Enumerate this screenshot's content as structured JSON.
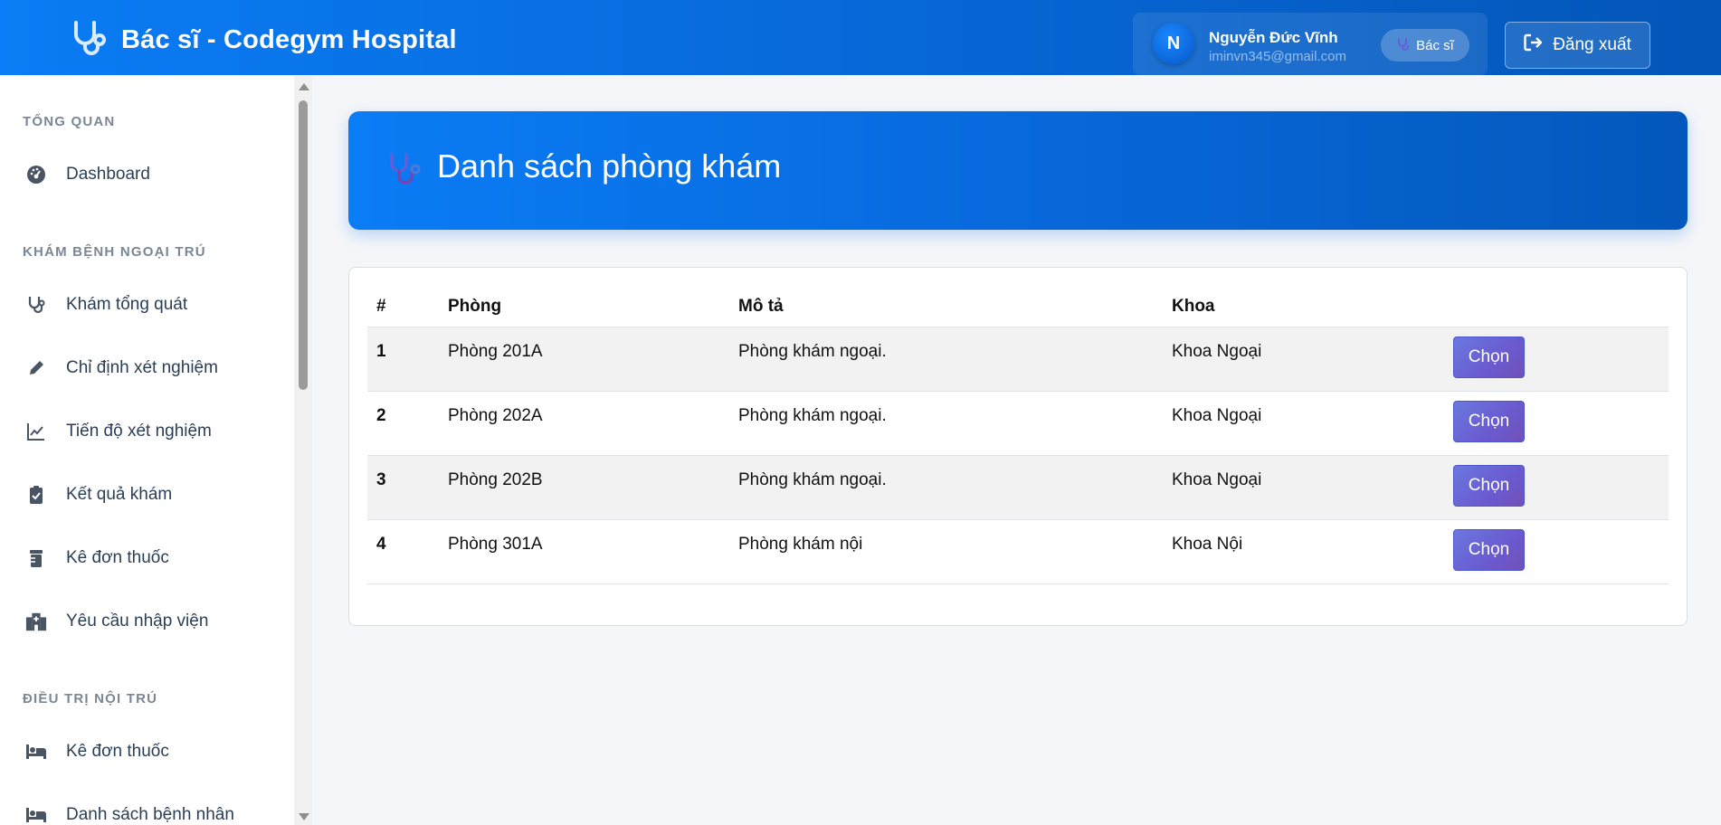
{
  "header": {
    "brand_title": "Bác sĩ - Codegym Hospital",
    "user_initial": "N",
    "user_name": "Nguyễn Đức Vĩnh",
    "user_email": "iminvn345@gmail.com",
    "role_label": "Bác sĩ",
    "logout_label": "Đăng xuất"
  },
  "sidebar": {
    "sections": [
      {
        "title": "TỔNG QUAN"
      },
      {
        "title": "KHÁM BỆNH NGOẠI TRÚ"
      },
      {
        "title": "ĐIỀU TRỊ NỘI TRÚ"
      }
    ],
    "items": [
      {
        "label": "Dashboard",
        "icon": "gauge-icon"
      },
      {
        "label": "Khám tổng quát",
        "icon": "stethoscope-icon"
      },
      {
        "label": "Chỉ định xét nghiệm",
        "icon": "pen-icon"
      },
      {
        "label": "Tiến độ xét nghiệm",
        "icon": "line-chart-icon"
      },
      {
        "label": "Kết quả khám",
        "icon": "clipboard-check-icon"
      },
      {
        "label": "Kê đơn thuốc",
        "icon": "prescription-bottle-icon"
      },
      {
        "label": "Yêu cầu nhập viện",
        "icon": "hospital-building-icon"
      },
      {
        "label": "Kê đơn thuốc",
        "icon": "bed-icon"
      },
      {
        "label": "Danh sách bệnh nhân",
        "icon": "bed-icon"
      }
    ]
  },
  "main": {
    "title": "Danh sách phòng khám",
    "table": {
      "headers": [
        "#",
        "Phòng",
        "Mô tả",
        "Khoa",
        ""
      ],
      "rows": [
        {
          "idx": "1",
          "room": "Phòng 201A",
          "desc": "Phòng khám ngoại.",
          "dept": "Khoa Ngoại",
          "action": "Chọn"
        },
        {
          "idx": "2",
          "room": "Phòng 202A",
          "desc": "Phòng khám ngoại.",
          "dept": "Khoa Ngoại",
          "action": "Chọn"
        },
        {
          "idx": "3",
          "room": "Phòng 202B",
          "desc": "Phòng khám ngoại.",
          "dept": "Khoa Ngoại",
          "action": "Chọn"
        },
        {
          "idx": "4",
          "room": "Phòng 301A",
          "desc": "Phòng khám nội",
          "dept": "Khoa Nội",
          "action": "Chọn"
        }
      ]
    }
  },
  "colors": {
    "primary": "#0a7cf5",
    "primary_dark": "#0458bb",
    "button": "#6a5ad0",
    "sidebar_text": "#2c3e55",
    "section_text": "#7b8794"
  }
}
